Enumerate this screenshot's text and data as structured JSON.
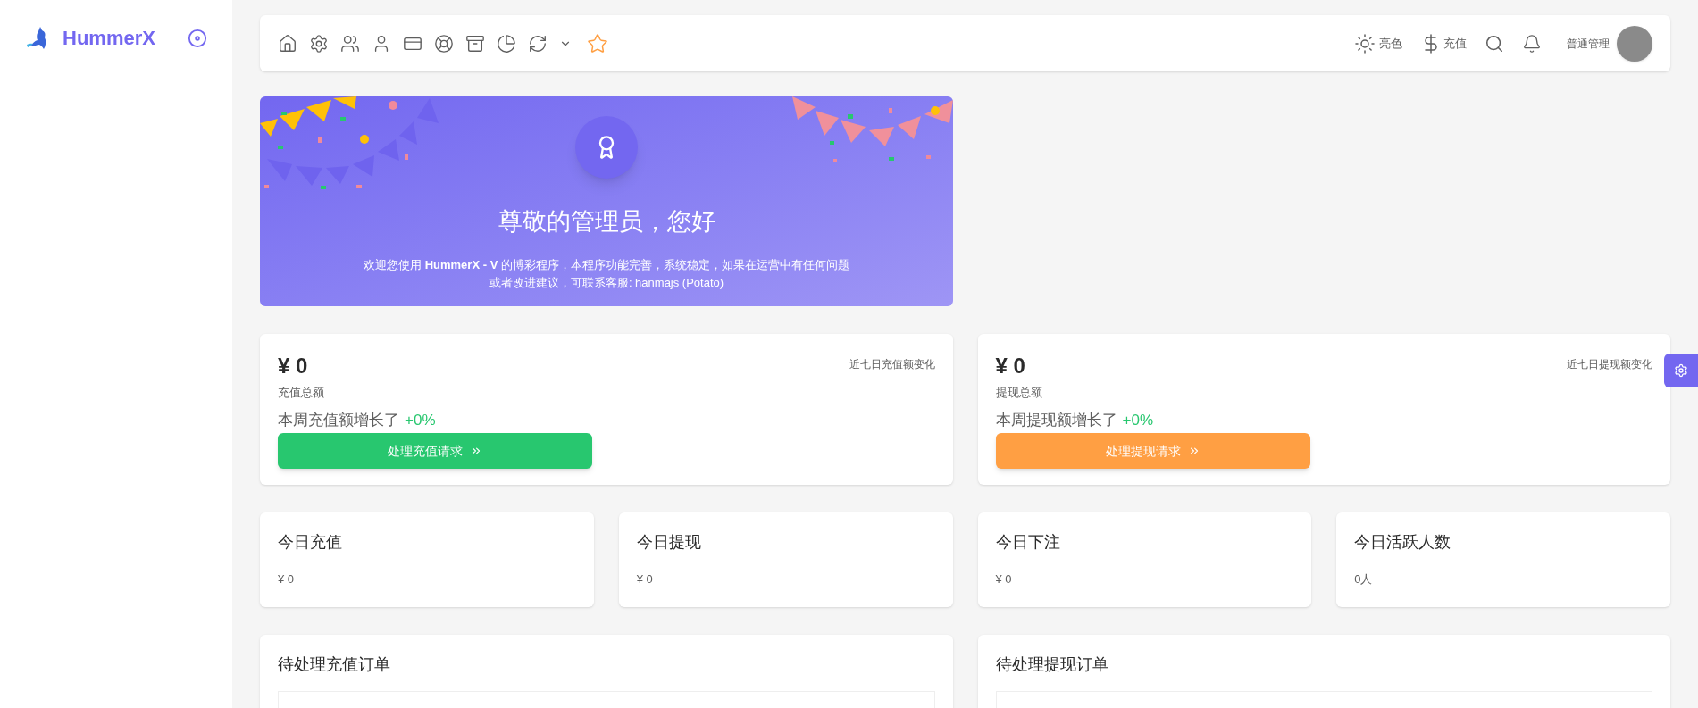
{
  "brand": {
    "name": "HummerX"
  },
  "header": {
    "theme_label": "亮色",
    "recharge_label": "充值",
    "user_name": "普通管理"
  },
  "banner": {
    "title": "尊敬的管理员，您好",
    "text": "欢迎您使用 **HummerX - V** 的博彩程序，本程序功能完善，系统稳定，如果在运营中有任何问题或者改进建议，可联系客服: hanmajs (Potato)"
  },
  "summary_cards": [
    {
      "amount": "¥ 0",
      "label": "充值总额",
      "chart_label": "近七日充值额变化",
      "growth_text": "本周充值额增长了",
      "growth_value": "+0%",
      "button": "处理充值请求",
      "color": "#28c76f"
    },
    {
      "amount": "¥ 0",
      "label": "提现总额",
      "chart_label": "近七日提现额变化",
      "growth_text": "本周提现额增长了",
      "growth_value": "+0%",
      "button": "处理提现请求",
      "color": "#ff9f43"
    }
  ],
  "today_stats": [
    {
      "title": "今日充值",
      "value": "¥ 0"
    },
    {
      "title": "今日提现",
      "value": "¥ 0"
    },
    {
      "title": "今日下注",
      "value": "¥ 0"
    },
    {
      "title": "今日活跃人数",
      "value": "0人"
    }
  ],
  "order_panels": [
    {
      "title": "待处理充值订单"
    },
    {
      "title": "待处理提现订单"
    }
  ]
}
